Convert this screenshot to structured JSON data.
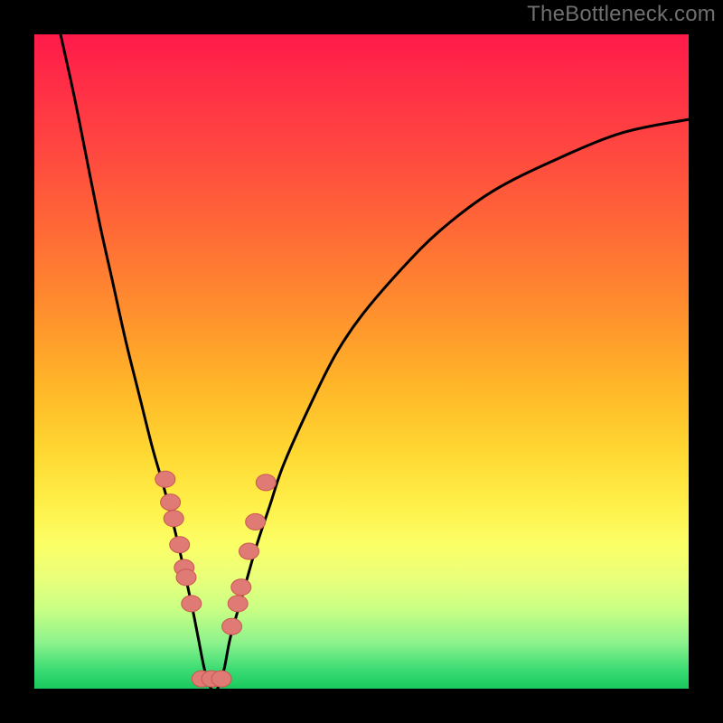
{
  "watermark": "TheBottleneck.com",
  "colors": {
    "background_frame": "#000000",
    "gradient_top": "#ff1a4a",
    "gradient_bottom": "#18c85e",
    "curve": "#000000",
    "markers_fill": "#e07a74",
    "markers_stroke": "#c95851",
    "watermark": "#6f6f6f"
  },
  "chart_data": {
    "type": "line",
    "title": "",
    "xlabel": "",
    "ylabel": "",
    "xlim": [
      0,
      100
    ],
    "ylim": [
      0,
      100
    ],
    "notes": "V-shaped bottleneck curve. X axis: relative component strength; Y axis: bottleneck percentage. Minimum near x≈27 where bottleneck≈0. Values are estimated from pixel positions; axes have no visible tick labels.",
    "series": [
      {
        "name": "bottleneck-curve",
        "x": [
          4,
          6,
          8,
          10,
          12,
          14,
          16,
          18,
          20,
          22,
          24,
          25,
          26,
          27,
          28,
          29,
          30,
          32,
          34,
          36,
          38,
          42,
          46,
          50,
          56,
          62,
          70,
          80,
          90,
          100
        ],
        "y": [
          100,
          91,
          81,
          71,
          62,
          53,
          45,
          37,
          30,
          22,
          13,
          8,
          3,
          0,
          0,
          3,
          8,
          15,
          22,
          28,
          34,
          43,
          51,
          57,
          64,
          70,
          76,
          81,
          85,
          87
        ]
      }
    ],
    "markers": {
      "name": "highlighted-points",
      "comment": "Salmon dot markers clustered around the valley of the V.",
      "x": [
        20.0,
        20.8,
        21.3,
        22.2,
        22.9,
        23.2,
        24.0,
        25.6,
        27.1,
        28.6,
        30.2,
        31.1,
        31.6,
        32.8,
        33.8,
        35.4
      ],
      "y": [
        32.0,
        28.5,
        26.0,
        22.0,
        18.5,
        17.0,
        13.0,
        1.5,
        1.5,
        1.5,
        9.5,
        13.0,
        15.5,
        21.0,
        25.5,
        31.5
      ]
    }
  }
}
